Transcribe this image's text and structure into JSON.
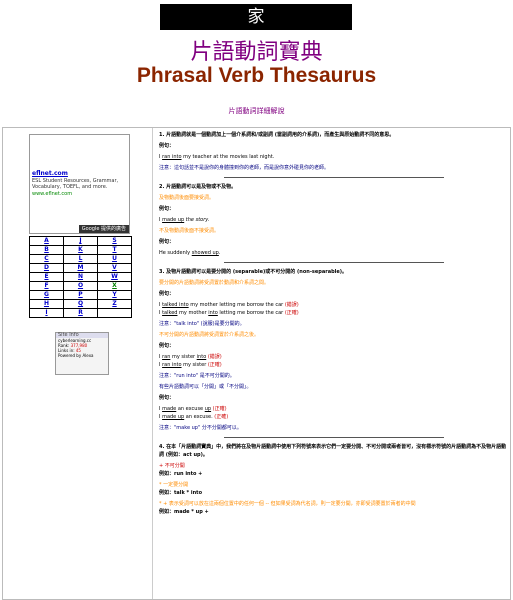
{
  "header": {
    "home_char": "家",
    "title_zh": "片語動詞寶典",
    "title_en": "Phrasal Verb Thesaurus",
    "sub_link": "片語動詞詳細解說"
  },
  "ad": {
    "title": "eflnet.com",
    "desc": "ESL Student Resources, Grammar, Vocabulary, TOEFL, and more.",
    "url": "www.eflnet.com",
    "badge": "Google 提供的廣告"
  },
  "alphabet": [
    [
      "A",
      "J",
      "S"
    ],
    [
      "B",
      "K",
      "T"
    ],
    [
      "C",
      "L",
      "U"
    ],
    [
      "D",
      "M",
      "V"
    ],
    [
      "E",
      "N",
      "W"
    ],
    [
      "F",
      "O",
      "X"
    ],
    [
      "G",
      "P",
      "Y"
    ],
    [
      "H",
      "Q",
      "Z"
    ],
    [
      "I",
      "R",
      ""
    ]
  ],
  "site_info": {
    "title": "Site Info",
    "domain": "cyberlearning.cc",
    "rank_label": "Rank:",
    "rank": "377,980",
    "links_label": "Links in:",
    "links": "45",
    "powered": "Powered by Alexa"
  },
  "content": {
    "s1": "1. 片語動詞就是一個動詞加上一個介系詞和/或副詞 (當副詞用的介系詞)，而產生與原始動詞不同的意思。",
    "ex": "例句：",
    "s1_ex_a": "I ",
    "s1_ex_link": "ran into",
    "s1_ex_b": " my teacher at the movies last night.",
    "s1_note": "注意：這句話並不是說你的身體撞到你的老師，而是說你意外碰見你的老師。",
    "s2": "2. 片語動詞可以是及物或不及物。",
    "s2_trans": "及物動詞後面要接受詞。",
    "s2_ex1_a": "I ",
    "s2_ex1_link": "made up",
    "s2_ex1_b": " the story.",
    "s2_intrans": "不及物動詞後面不接受詞。",
    "s2_ex2_a": "He suddenly ",
    "s2_ex2_link": "showed up",
    "s2_ex2_b": ".",
    "s3": "3. 及物片語動詞可以是要分開的 (separable)或不可分開的 (non-separable)。",
    "s3_sep": "要分開的片語動詞將受詞置於動詞和介系詞之間。",
    "s3_ex1_a": "I ",
    "s3_ex1_link": "talked into",
    "s3_ex1_b": " my mother letting me borrow the car ",
    "s3_ex1_tag": "(錯誤)",
    "s3_ex2_a": "I ",
    "s3_ex2_link": "talked",
    "s3_ex2_b": " my mother ",
    "s3_ex2_link2": "into",
    "s3_ex2_c": " letting me borrow the car ",
    "s3_ex2_tag": "(正確)",
    "s3_note1": "注意：\"talk into\" (說服)是要分開的。",
    "s3_nonsep": "不可分開的片語動詞將受詞置於介系詞之後。",
    "s3_ex3_a": "I ",
    "s3_ex3_link": "ran",
    "s3_ex3_b": " my sister ",
    "s3_ex3_link2": "into",
    "s3_ex3_tag": " (錯誤)",
    "s3_ex4_a": "I ",
    "s3_ex4_link": "ran into",
    "s3_ex4_b": " my sister ",
    "s3_ex4_tag": "(正確)",
    "s3_note2": "注意：\"run into\" 是不可分開的。",
    "s3_note3": "有些片語動詞可以「分開」或「不分開」。",
    "s3_ex5_a": "I ",
    "s3_ex5_link": "made",
    "s3_ex5_b": " an excuse ",
    "s3_ex5_link2": "up",
    "s3_ex5_tag": " (正確)",
    "s3_ex6_a": "I ",
    "s3_ex6_link": "made up",
    "s3_ex6_b": " an excuse. ",
    "s3_ex6_tag": "(正確)",
    "s3_note4": "注意：\"make up\" 分不分開都可以。",
    "s4": "4. 在本「片語動詞寶典」中，我們將在及物片語動詞中使用下列符號來表示它們一定要分開、不可分開或兩者皆可，沒有標示符號的片語動詞為不及物片語動詞 (例如：act up)。",
    "s4_a_mark": "+ 不可分開",
    "s4_a_ex": "例如：run into +",
    "s4_b_mark": "* 一定要分開",
    "s4_b_ex": "例如：talk * into",
    "s4_c_mark": "* + 表示受詞可以放在這兩個位置中的任何一個 -- 但如果受詞為代名詞，則一定要分開，亦即受詞要置於兩者的中間",
    "s4_c_ex": "例如：made * up +"
  }
}
